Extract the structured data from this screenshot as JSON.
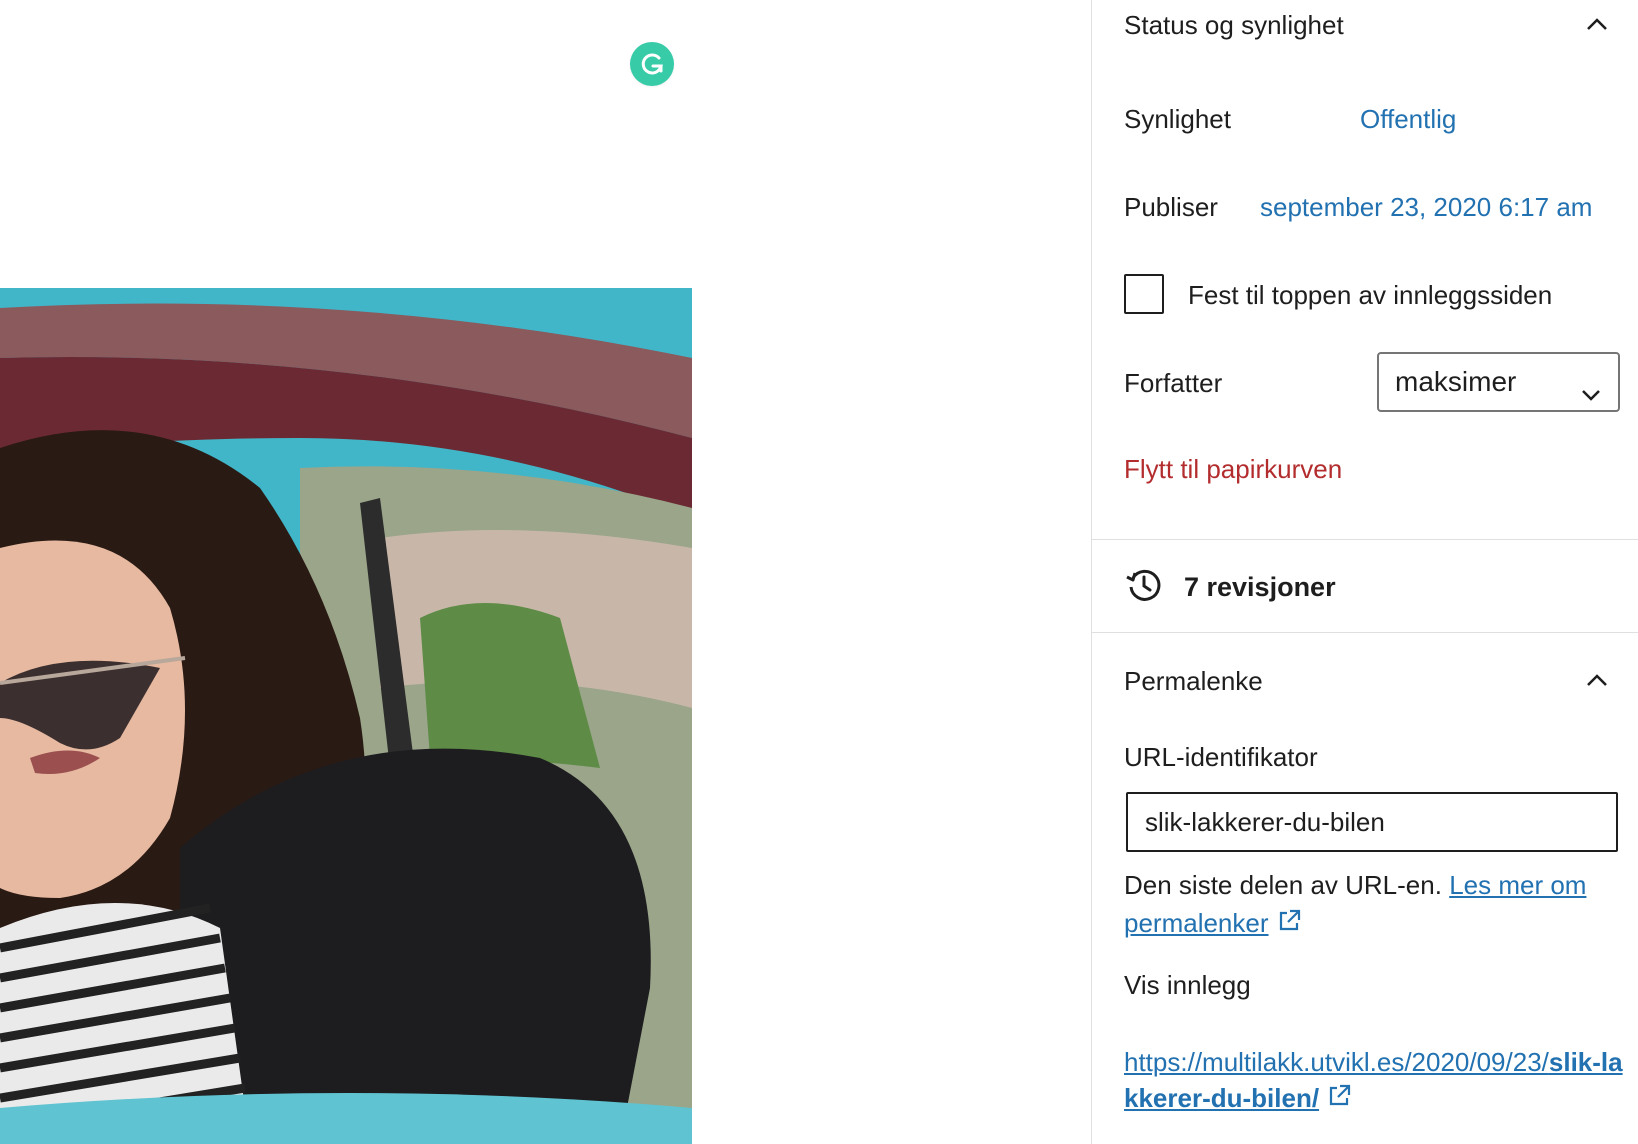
{
  "editor": {
    "grammarly_icon": "grammarly-icon",
    "image_alt": "woman-in-car-photo"
  },
  "status_panel": {
    "title": "Status og synlighet",
    "visibility_label": "Synlighet",
    "visibility_value": "Offentlig",
    "publish_label": "Publiser",
    "publish_value": "september 23, 2020 6:17 am",
    "sticky_label": "Fest til toppen av innleggssiden",
    "sticky_checked": false,
    "author_label": "Forfatter",
    "author_value": "maksimer",
    "trash_label": "Flytt til papirkurven"
  },
  "revisions": {
    "label": "7 revisjoner"
  },
  "permalink_panel": {
    "title": "Permalenke",
    "slug_label": "URL-identifikator",
    "slug_value": "slik-lakkerer-du-bilen",
    "help_text": "Den siste delen av URL-en.",
    "help_link": "Les mer om permalenker",
    "view_label": "Vis innlegg",
    "url_prefix": "https://multilakk.utvikl.es/2020/09/23/",
    "url_slug": "slik-lakkerer-du-bilen/"
  },
  "colors": {
    "link": "#2271b1",
    "danger": "#b32d2e",
    "grammarly": "#15c39a"
  }
}
